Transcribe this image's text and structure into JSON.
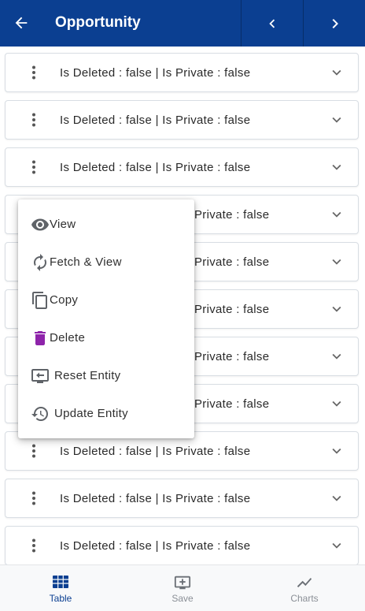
{
  "header": {
    "title": "Opportunity",
    "back_icon": "arrow-left-icon",
    "prev_icon": "chevron-left-icon",
    "next_icon": "chevron-right-icon"
  },
  "rows": [
    {
      "text": "Is Deleted  : false | Is Private  : false"
    },
    {
      "text": "Is Deleted  : false | Is Private  : false"
    },
    {
      "text": "Is Deleted  : false | Is Private  : false"
    },
    {
      "text": "Private  : false"
    },
    {
      "text": "Private  : false"
    },
    {
      "text": "Private  : false"
    },
    {
      "text": "Private  : false"
    },
    {
      "text": "Private  : false"
    },
    {
      "text": "Is Deleted  : false | Is Private  : false"
    },
    {
      "text": "Is Deleted  : false | Is Private  : false"
    },
    {
      "text": "Is Deleted  : false | Is Private  : false"
    }
  ],
  "context_menu": {
    "items": [
      {
        "label": "View",
        "icon": "eye-icon"
      },
      {
        "label": "Fetch & View",
        "icon": "refresh-icon"
      },
      {
        "label": "Copy",
        "icon": "copy-icon"
      },
      {
        "label": "Delete",
        "icon": "trash-icon"
      },
      {
        "label": "Reset Entity",
        "icon": "reset-entity-icon"
      },
      {
        "label": "Update Entity",
        "icon": "history-icon"
      }
    ]
  },
  "bottom_nav": {
    "items": [
      {
        "label": "Table",
        "icon": "table-icon",
        "active": true
      },
      {
        "label": "Save",
        "icon": "save-monitor-icon",
        "active": false
      },
      {
        "label": "Charts",
        "icon": "line-chart-icon",
        "active": false
      }
    ]
  },
  "colors": {
    "header_bg": "#0b3f91",
    "active_nav": "#0b3f91",
    "inactive_nav": "#8a8f96",
    "delete_icon": "#8e24aa",
    "icon_gray": "#5f6368"
  }
}
